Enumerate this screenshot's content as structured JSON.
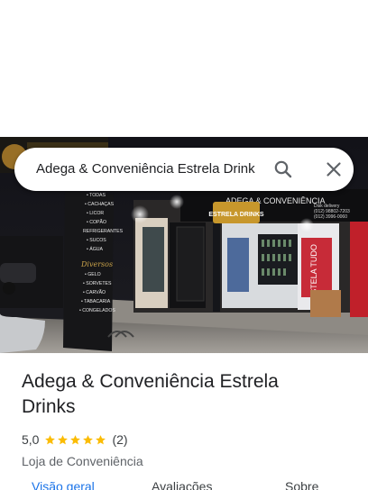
{
  "search": {
    "query": "Adega & Conveniência Estrela Drink"
  },
  "place": {
    "name": "Adega & Conveniência Estrela Drinks",
    "rating": "5,0",
    "stars": 5,
    "review_count": "(2)",
    "category": "Loja de Conveniência"
  },
  "photo": {
    "sign_brand": "ESTRELA DRINKS",
    "sign_banner": "ADEGA & CONVENIÊNCIA",
    "phones": [
      "Disk delivery",
      "(012) 98802-7203",
      "(012) 3996-0060"
    ],
    "pillar_items_top": [
      "• TODAS",
      "• CACHAÇAS",
      "• LICOR",
      "• COPÃO",
      "REFRIGERANTES",
      "• SUCOS",
      "• ÁGUA"
    ],
    "pillar_title": "Diversos",
    "pillar_items_bottom": [
      "• GELO",
      "• SORVETES",
      "• CARVÃO",
      "• TABACARIA",
      "• CONGELADOS"
    ],
    "banner_text": "ESTELA TUDO"
  },
  "tabs": [
    {
      "label": "Visão geral",
      "active": true
    },
    {
      "label": "Avaliações",
      "active": false
    },
    {
      "label": "Sobre",
      "active": false
    }
  ],
  "colors": {
    "accent": "#1a73e8",
    "star": "#fbbc04",
    "text": "#202124",
    "muted": "#5f6368"
  },
  "icons": {
    "search": "search-icon",
    "close": "close-icon",
    "star": "star-icon"
  }
}
